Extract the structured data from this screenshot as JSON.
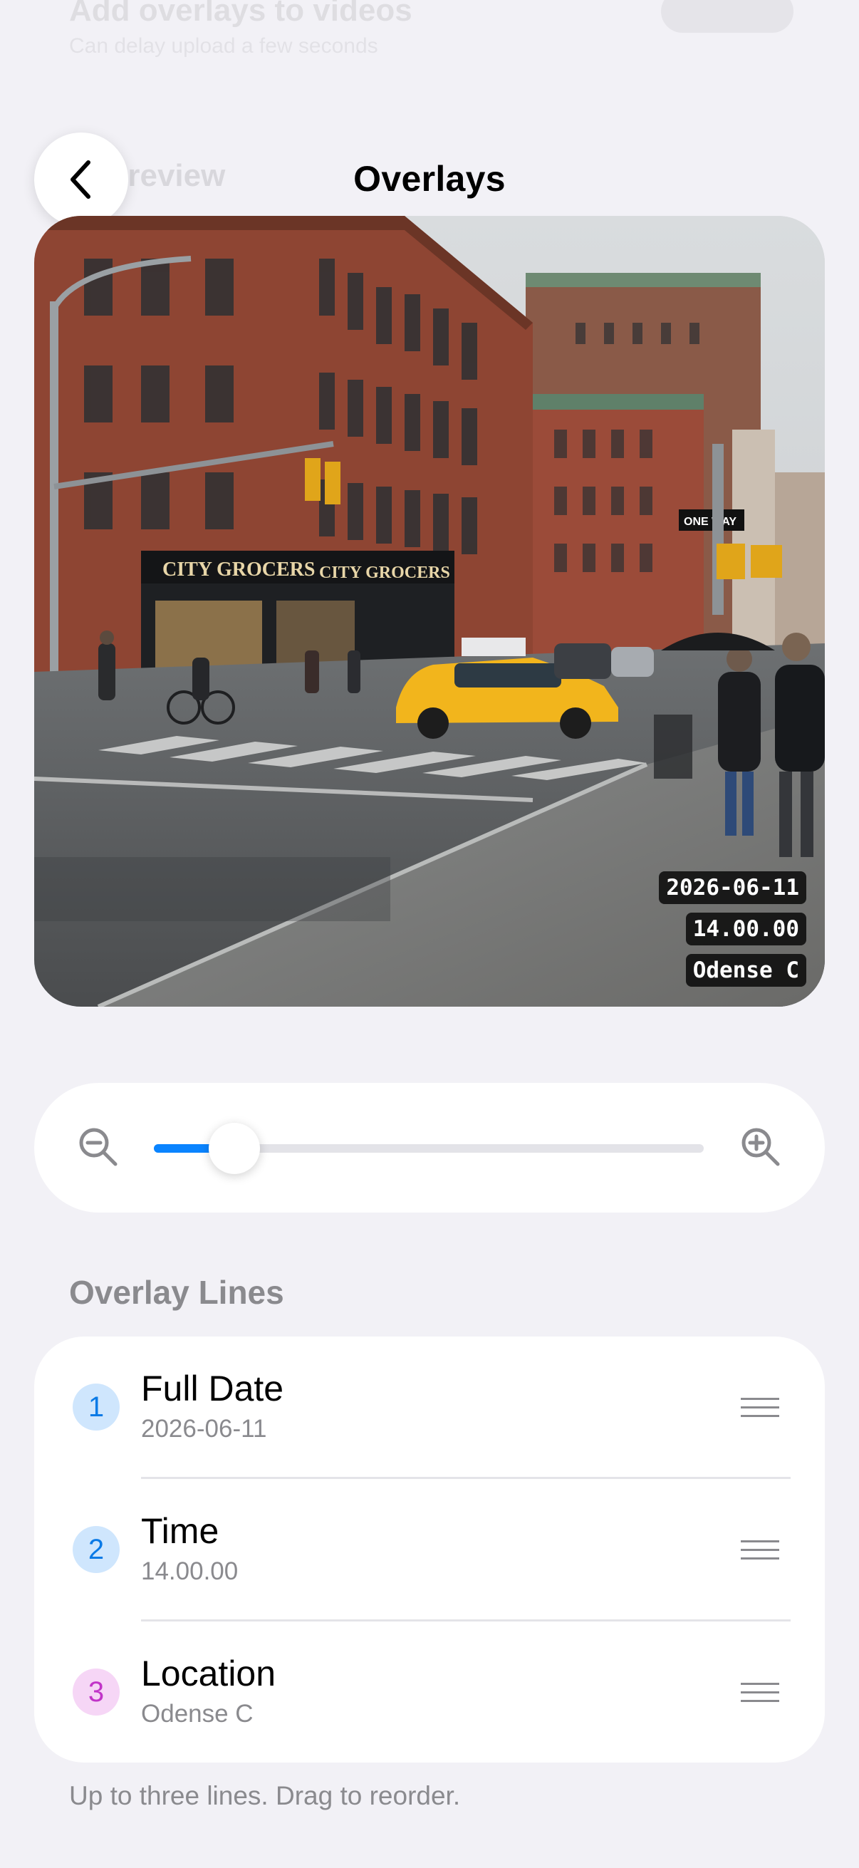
{
  "background": {
    "setting_title": "Add overlays to videos",
    "setting_subtitle": "Can delay upload a few seconds",
    "section_title": "Preview"
  },
  "header": {
    "title": "Overlays",
    "back_icon": "chevron-left-icon"
  },
  "preview": {
    "storefront_sign": "CITY GROCERS",
    "storefront_sign_2": "CITY GROCERS",
    "street_sign": "ONE WAY",
    "stamps": [
      "2026-06-11",
      "14.00.00",
      "Odense C"
    ]
  },
  "zoom": {
    "zoom_out_icon": "zoom-out-icon",
    "zoom_in_icon": "zoom-in-icon",
    "level": 0.1,
    "accent": "#0a84ff"
  },
  "overlay_lines": {
    "section_label": "Overlay Lines",
    "items": [
      {
        "number": "1",
        "title": "Full Date",
        "value": "2026-06-11",
        "badge_bg": "#cfe6fd",
        "badge_fg": "#0a7ae6"
      },
      {
        "number": "2",
        "title": "Time",
        "value": "14.00.00",
        "badge_bg": "#cfe6fd",
        "badge_fg": "#0a7ae6"
      },
      {
        "number": "3",
        "title": "Location",
        "value": "Odense C",
        "badge_bg": "#f6d6f6",
        "badge_fg": "#c134c8"
      }
    ],
    "footnote": "Up to three lines. Drag to reorder."
  }
}
